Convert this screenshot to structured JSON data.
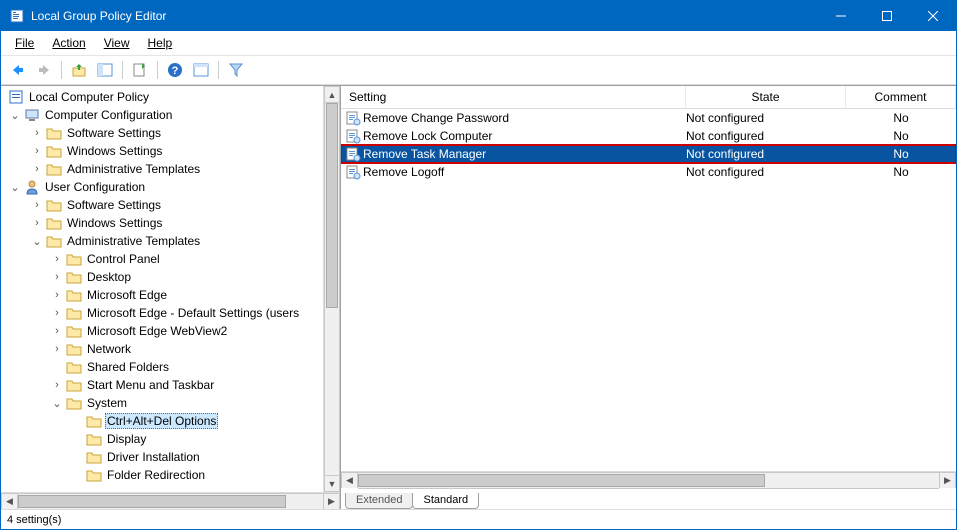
{
  "window": {
    "title": "Local Group Policy Editor"
  },
  "menu": {
    "file": "File",
    "action": "Action",
    "view": "View",
    "help": "Help"
  },
  "tree": {
    "root": "Local Computer Policy",
    "computer_config": "Computer Configuration",
    "cc_software": "Software Settings",
    "cc_windows": "Windows Settings",
    "cc_admin": "Administrative Templates",
    "user_config": "User Configuration",
    "uc_software": "Software Settings",
    "uc_windows": "Windows Settings",
    "uc_admin": "Administrative Templates",
    "control_panel": "Control Panel",
    "desktop": "Desktop",
    "edge": "Microsoft Edge",
    "edge_default": "Microsoft Edge - Default Settings (users",
    "edge_webview": "Microsoft Edge WebView2",
    "network": "Network",
    "shared_folders": "Shared Folders",
    "start_taskbar": "Start Menu and Taskbar",
    "system": "System",
    "ctrl_alt_del": "Ctrl+Alt+Del Options",
    "display": "Display",
    "driver_install": "Driver Installation",
    "folder_redir": "Folder Redirection"
  },
  "list": {
    "header_setting": "Setting",
    "header_state": "State",
    "header_comment": "Comment",
    "items": [
      {
        "name": "Remove Change Password",
        "state": "Not configured",
        "comment": "No",
        "selected": false
      },
      {
        "name": "Remove Lock Computer",
        "state": "Not configured",
        "comment": "No",
        "selected": false
      },
      {
        "name": "Remove Task Manager",
        "state": "Not configured",
        "comment": "No",
        "selected": true
      },
      {
        "name": "Remove Logoff",
        "state": "Not configured",
        "comment": "No",
        "selected": false
      }
    ]
  },
  "tabs": {
    "extended": "Extended",
    "standard": "Standard"
  },
  "status": "4 setting(s)"
}
